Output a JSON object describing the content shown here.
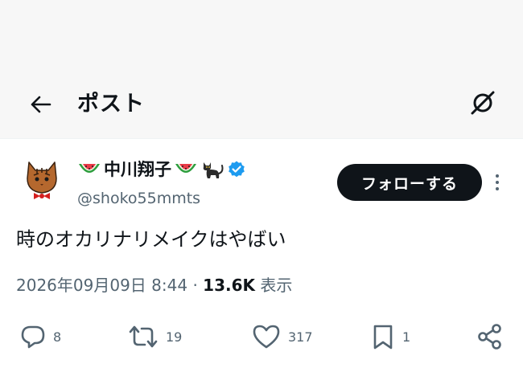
{
  "header": {
    "title": "ポスト",
    "back_icon": "arrow-left-icon",
    "grok_icon": "grok-icon"
  },
  "post": {
    "author": {
      "display_name": "中川翔子",
      "handle": "@shoko55mmts",
      "verified": true,
      "verified_color": "#1d9bf0",
      "name_emojis": [
        "watermelon-icon",
        "watermelon-icon",
        "black-cat-icon"
      ]
    },
    "follow_label": "フォローする",
    "text": "時のオカリナリメイクはやばい",
    "timestamp": "2026年09月09日 8:44",
    "separator": "·",
    "views_count": "13.6K",
    "views_label": "表示"
  },
  "actions": {
    "reply_count": "8",
    "repost_count": "19",
    "like_count": "317",
    "bookmark_count": "1"
  },
  "colors": {
    "text_primary": "#0f1419",
    "text_secondary": "#536471",
    "header_bg": "#f7f7f7",
    "follow_bg": "#0f1419"
  }
}
